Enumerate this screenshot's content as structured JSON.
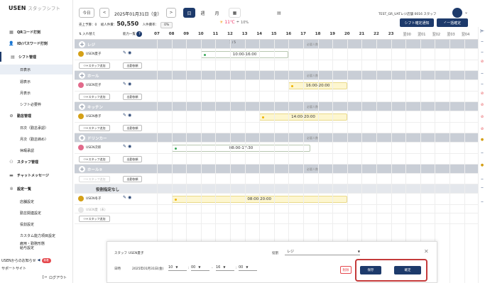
{
  "sidebar": {
    "brand": "USEN",
    "brand_sub": "スタッフシフト",
    "items": [
      {
        "label": "QRコード打刻",
        "icon": "qr-icon"
      },
      {
        "label": "ID/パスワード打刻",
        "icon": "id-icon"
      },
      {
        "label": "シフト管理",
        "icon": "calendar-icon"
      },
      {
        "label": "日表示"
      },
      {
        "label": "週表示"
      },
      {
        "label": "月表示"
      },
      {
        "label": "シフト必要枠"
      },
      {
        "label": "勤怠管理",
        "icon": "check-icon"
      },
      {
        "label": "日次（勤怠承認）"
      },
      {
        "label": "月次（勤怠締め）"
      },
      {
        "label": "休暇承認"
      },
      {
        "label": "スタッフ管理",
        "icon": "staff-icon"
      },
      {
        "label": "チャットメッセージ",
        "icon": "chat-icon"
      },
      {
        "label": "設定一覧",
        "icon": "gear-icon"
      },
      {
        "label": "店舗設定"
      },
      {
        "label": "勤怠関連設定"
      },
      {
        "label": "役割設定"
      },
      {
        "label": "カスタム能力項目設定"
      },
      {
        "label": "雇用・勤務形態\n給与設定"
      }
    ],
    "notice": "USENからのお知らせ",
    "notice_badge": "新着",
    "support": "サポートサイト",
    "logout": "ログアウト"
  },
  "topbar": {
    "today": "今日",
    "date": "2025年01月31日（金）",
    "view_day": "日",
    "view_week": "週",
    "view_month": "月",
    "kpi_sales_label": "売上予算：",
    "kpi_sales_value": "0",
    "kpi_cost_label": "総人件費：",
    "kpi_cost_value": "50,550",
    "kpi_rate_label": "人件費率：",
    "kpi_rate_value": "0%",
    "weather_temp": "11℃",
    "weather_rain": "10%",
    "store_name": "TEST_GR_UATレジ店舗 0016 スタッフ",
    "btn_notify": "シフト確定通知",
    "btn_confirm_all": "一括確定"
  },
  "grid": {
    "sort_label": "入れ替え",
    "ability_label": "能力一覧",
    "hours": [
      "07",
      "08",
      "09",
      "10",
      "11",
      "12",
      "13",
      "14",
      "15",
      "16",
      "17",
      "18",
      "19",
      "20",
      "21",
      "22",
      "23",
      "翌00",
      "翌01",
      "翌02",
      "翌03",
      "翌04"
    ],
    "needs_label": "必要人数",
    "add_staff": "スタッフ追加",
    "dispatch": "出勤依頼",
    "count_text": "1 / 5",
    "categories": [
      {
        "name": "レジ",
        "person": "USEN夏子",
        "shift": "10:00-16:00",
        "color": "green"
      },
      {
        "name": "ホール",
        "person": "USEN花子",
        "shift": "16:00-20:00",
        "color": "yellow"
      },
      {
        "name": "キッチン",
        "person": "USEN春子",
        "shift": "14:00-20:00",
        "color": "yellow"
      },
      {
        "name": "ドリンカー",
        "person": "USEN次郎",
        "shift": "08:00-17:30",
        "color": "green"
      },
      {
        "name": "ホール②",
        "person": "",
        "shift": "",
        "color": ""
      },
      {
        "name": "役割指定なし",
        "person": "USEN冬子",
        "shift": "08:00-20:00",
        "color": "yellow"
      }
    ],
    "ghost_person": "USEN夏（未）"
  },
  "modal": {
    "staff_label": "スタッフ",
    "staff_value": "USEN夏子",
    "role_label": "役割",
    "role_value": "レジ",
    "date_label": "日時",
    "date_value": "2025年01月31日(金)",
    "start_h": "10",
    "start_m": "00",
    "end_h": "16",
    "end_m": "00",
    "delete": "削除",
    "save": "保存",
    "confirm": "確定"
  },
  "colors": {
    "navy": "#1d3a6b",
    "highlight": "#c43a3a"
  }
}
